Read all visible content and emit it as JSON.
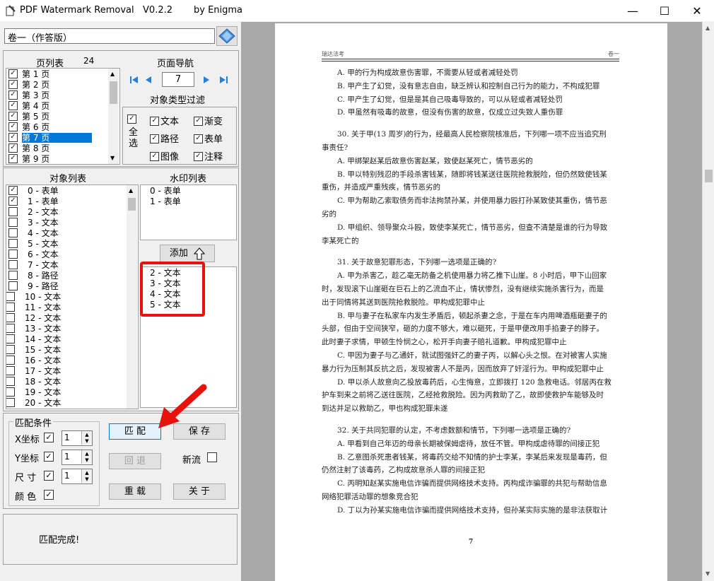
{
  "window": {
    "title": "PDF Watermark Removal   V0.2.2",
    "author": "by  Enigma",
    "min": "—",
    "max": "☐",
    "close": "✕"
  },
  "file_field": {
    "value": "卷一（作答版）"
  },
  "page_list": {
    "header": "页列表",
    "count": "24",
    "items": [
      {
        "label": "第 1 页",
        "checked": true
      },
      {
        "label": "第 2 页",
        "checked": true
      },
      {
        "label": "第 3 页",
        "checked": true
      },
      {
        "label": "第 4 页",
        "checked": true
      },
      {
        "label": "第 5 页",
        "checked": true
      },
      {
        "label": "第 6 页",
        "checked": true
      },
      {
        "label": "第 7 页",
        "checked": true,
        "selected": true
      },
      {
        "label": "第 8 页",
        "checked": true
      },
      {
        "label": "第 9 页",
        "checked": true
      }
    ]
  },
  "page_nav": {
    "header": "页面导航",
    "current": "7"
  },
  "type_filter": {
    "header": "对象类型过滤",
    "all_label": "全\n选",
    "items": [
      {
        "label": "文本",
        "checked": true
      },
      {
        "label": "渐变",
        "checked": true
      },
      {
        "label": "路径",
        "checked": true
      },
      {
        "label": "表单",
        "checked": true
      },
      {
        "label": "图像",
        "checked": true
      },
      {
        "label": "注释",
        "checked": true
      }
    ]
  },
  "object_list": {
    "header": "对象列表",
    "items": [
      {
        "label": "0 - 表单",
        "checked": true
      },
      {
        "label": "1 - 表单",
        "checked": true
      },
      {
        "label": "2 - 文本",
        "checked": false
      },
      {
        "label": "3 - 文本",
        "checked": false
      },
      {
        "label": "4 - 文本",
        "checked": false
      },
      {
        "label": "5 - 文本",
        "checked": false
      },
      {
        "label": "6 - 文本",
        "checked": false
      },
      {
        "label": "7 - 文本",
        "checked": false
      },
      {
        "label": "8 - 路径",
        "checked": false
      },
      {
        "label": "9 - 路径",
        "checked": false
      },
      {
        "label": "10 - 文本",
        "checked": false
      },
      {
        "label": "11 - 文本",
        "checked": false
      },
      {
        "label": "12 - 文本",
        "checked": false
      },
      {
        "label": "13 - 文本",
        "checked": false
      },
      {
        "label": "14 - 文本",
        "checked": false
      },
      {
        "label": "15 - 文本",
        "checked": false
      },
      {
        "label": "16 - 文本",
        "checked": false
      },
      {
        "label": "17 - 文本",
        "checked": false
      },
      {
        "label": "18 - 文本",
        "checked": false
      },
      {
        "label": "19 - 文本",
        "checked": false
      },
      {
        "label": "20 - 文本",
        "checked": false
      }
    ]
  },
  "watermark_list": {
    "header": "水印列表",
    "items": [
      "0 - 表单",
      "1 - 表单"
    ]
  },
  "add_button": {
    "label": "添加"
  },
  "pending_list": {
    "items": [
      "2 - 文本",
      "3 - 文本",
      "4 - 文本",
      "5 - 文本"
    ]
  },
  "match_conditions": {
    "header": "匹配条件",
    "rows": [
      {
        "label": "X坐标",
        "checked": true,
        "value": "1"
      },
      {
        "label": "Y坐标",
        "checked": true,
        "value": "1"
      },
      {
        "label": "尺 寸",
        "checked": true,
        "value": "1"
      },
      {
        "label": "颜 色",
        "checked": true
      }
    ]
  },
  "buttons": {
    "match": "匹 配",
    "save": "保 存",
    "undo": "回 退",
    "reload": "重 载",
    "about": "关 于",
    "new_stream": "新流"
  },
  "status": {
    "text": "匹配完成!"
  },
  "document": {
    "header_left": "瑞达法考",
    "header_right": "卷一",
    "page_number": "7",
    "lines": [
      "A. 甲的行为构成故意伤害罪，不需要从轻或者减轻处罚",
      "B. 甲产生了幻觉，没有意志自由，缺乏辨认和控制自己行为的能力，不构成犯罪",
      "C. 甲产生了幻觉，但是是其自己吸毒导致的，可以从轻或者减轻处罚",
      "D. 甲虽然有吸毒的故意，但没有伤害的故意，仅成立过失致人重伤罪",
      "",
      "30. 关于甲(13 周岁)的行为，经最高人民检察院核准后，下列哪一项不应当追究刑",
      "事责任?",
      "A. 甲绑架赵某后故意伤害赵某，致使赵某死亡，情节恶劣的",
      "B. 甲以特别残忍的手段杀害钱某，随即将钱某送往医院抢救脱险，但仍然致使钱某",
      "重伤，并造成严重残疾，情节恶劣的",
      "C. 甲为帮助乙索取债务而非法拘禁孙某，并使用暴力殴打孙某致使其重伤，情节恶",
      "劣的",
      "D. 甲组织、领导聚众斗殴，致使李某死亡，情节恶劣，但查不清楚是谁的行为导致",
      "李某死亡的",
      "",
      "31. 关于故意犯罪形态，下列哪一选项是正确的?",
      "A. 甲为杀害乙，趁乙毫无防备之机使用暴力将乙推下山崖。8 小时后，甲下山回家",
      "时，发现滚下山崖砸在巨石上的乙流血不止，情状惨烈，没有继续实施杀害行为，而是",
      "出于同情将其送到医院抢救脱险。甲构成犯罪中止",
      "B. 甲与妻子在私家车内发生矛盾后，顿起杀妻之念，于是在车内用啤酒瓶砸妻子的",
      "头部，但由于空间狭窄，砸的力度不够大，难以砸死，于是甲便改用手掐妻子的脖子。",
      "此时妻子求情，甲顿生怜悯之心，松开手向妻子赔礼道歉。甲构成犯罪中止",
      "C. 甲因为妻子与乙通奸，就试图强奸乙的妻子丙，以解心头之恨。在对被害人实施",
      "暴力行为压制其反抗之后，发现被害人不是丙，因而放弃了奸淫行为。甲构成犯罪中止",
      "D. 甲以杀人故意向乙投放毒药后，心生悔意，立即拨打 120 急救电话。邻居丙在救",
      "护车到来之前将乙送往医院，乙经抢救脱险。因为丙救助了乙，故即使救护车能够及时",
      "到达并足以救助乙，甲也构成犯罪未遂",
      "",
      "32. 关于共同犯罪的认定，不考虑数额和情节，下列哪一选项是正确的?",
      "A. 甲看到自己年迈的母亲长期被保姆虐待，放任不管。甲构成虐待罪的间接正犯",
      "B. 乙意图杀死患者钱某，将毒药交给不知情的护士李某，李某后来发现是毒药，但",
      "仍然注射了该毒药，乙构成故意杀人罪的间接正犯",
      "C. 丙明知赵某实施电信诈骗而提供网络技术支持。丙构成诈骗罪的共犯与帮助信息",
      "网络犯罪活动罪的想象竞合犯",
      "D. 丁以为孙某实施电信诈骗而提供网络技术支持，但孙某实际实施的是非法获取计"
    ]
  },
  "colors": {
    "highlight_box": "#e8120c",
    "selection": "#0078d7",
    "viewer_bg": "#a8a8a8"
  }
}
